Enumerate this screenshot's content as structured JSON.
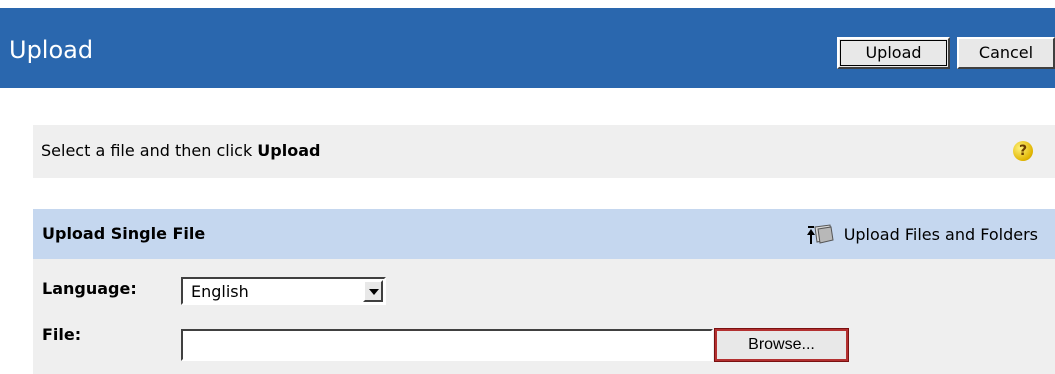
{
  "header": {
    "title": "Upload",
    "upload_label": "Upload",
    "cancel_label": "Cancel",
    "background": "#2a67ae"
  },
  "instructions": {
    "text_before": "Select a file and then click ",
    "text_bold": "Upload",
    "help_icon": "help-icon"
  },
  "panel": {
    "title": "Upload Single File",
    "link_label": "Upload Files and Folders",
    "link_icon": "upload-folder-icon",
    "header_background": "#c5d7ef"
  },
  "form": {
    "language_label": "Language:",
    "language_value": "English",
    "file_label": "File:",
    "file_value": "",
    "browse_label": "Browse..."
  }
}
